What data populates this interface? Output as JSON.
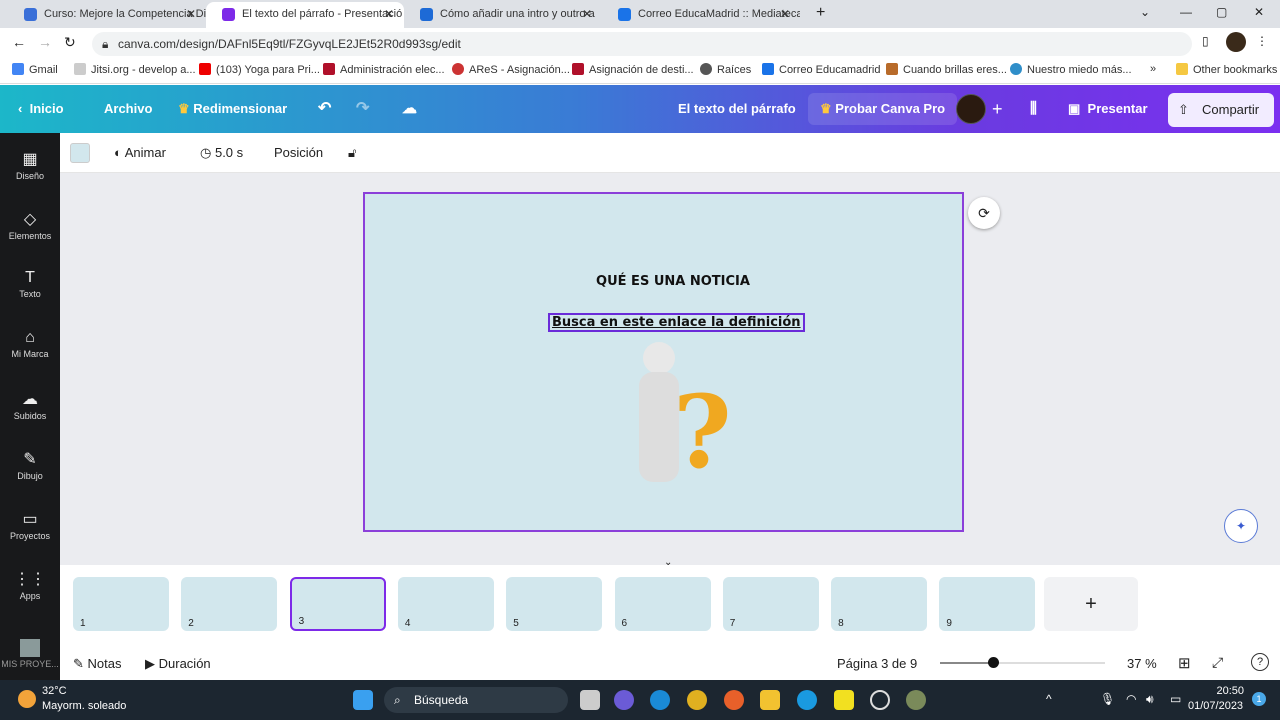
{
  "browser": {
    "tabs": [
      {
        "label": "Curso: Mejore la Competencia Di",
        "color": "#3a6fd8"
      },
      {
        "label": "El texto del párrafo - Presentació",
        "color": "#7d2ae8",
        "active": true
      },
      {
        "label": "Cómo añadir una intro y outro a",
        "color": "#1d6ad6"
      },
      {
        "label": "Correo EducaMadrid :: Mediateca",
        "color": "#1a73e8"
      }
    ],
    "url": "canva.com/design/DAFnl5Eq9tl/FZGyvqLE2JEt52R0d993sg/edit",
    "bookmarks": [
      {
        "label": "Gmail",
        "color": "#4285f4"
      },
      {
        "label": "Jitsi.org - develop a...",
        "color": "#bbb"
      },
      {
        "label": "(103) Yoga para Pri...",
        "color": "#e00"
      },
      {
        "label": "Administración elec...",
        "color": "#b0102a"
      },
      {
        "label": "AReS - Asignación...",
        "color": "#c33"
      },
      {
        "label": "Asignación de desti...",
        "color": "#b0102a"
      },
      {
        "label": "Raíces",
        "color": "#555"
      },
      {
        "label": "Correo Educamadrid",
        "color": "#1a73e8"
      },
      {
        "label": "Cuando brillas eres...",
        "color": "#b86b2a"
      },
      {
        "label": "Nuestro miedo más...",
        "color": "#2f8ec9"
      }
    ],
    "other_bookmarks": "Other bookmarks"
  },
  "header": {
    "home": "Inicio",
    "file": "Archivo",
    "resize": "Redimensionar",
    "doc_title": "El texto del párrafo",
    "pro": "Probar Canva Pro",
    "present": "Presentar",
    "share": "Compartir"
  },
  "toolbar": {
    "animate": "Animar",
    "duration": "5.0 s",
    "position": "Posición",
    "color": "#d2e7ed"
  },
  "sidebar": [
    {
      "label": "Diseño",
      "icon": "▦"
    },
    {
      "label": "Elementos",
      "icon": "◇"
    },
    {
      "label": "Texto",
      "icon": "T"
    },
    {
      "label": "Mi Marca",
      "icon": "⌂"
    },
    {
      "label": "Subidos",
      "icon": "☁"
    },
    {
      "label": "Dibujo",
      "icon": "✎"
    },
    {
      "label": "Proyectos",
      "icon": "▭"
    },
    {
      "label": "Apps",
      "icon": "⋮⋮"
    },
    {
      "label": "MIS PROYE..."
    }
  ],
  "slide": {
    "title": "QUÉ ES UNA NOTICIA",
    "link": "Busca en este enlace la definición"
  },
  "pages": [
    "1",
    "2",
    "3",
    "4",
    "5",
    "6",
    "7",
    "8",
    "9"
  ],
  "current_page": 3,
  "footer": {
    "notes": "Notas",
    "duration": "Duración",
    "page_info": "Página 3 de 9",
    "zoom": "37 %",
    "zoom_value": 37
  },
  "taskbar": {
    "temp": "32°C",
    "weather": "Mayorm. soleado",
    "search": "Búsqueda",
    "time": "20:50",
    "date": "01/07/2023"
  }
}
